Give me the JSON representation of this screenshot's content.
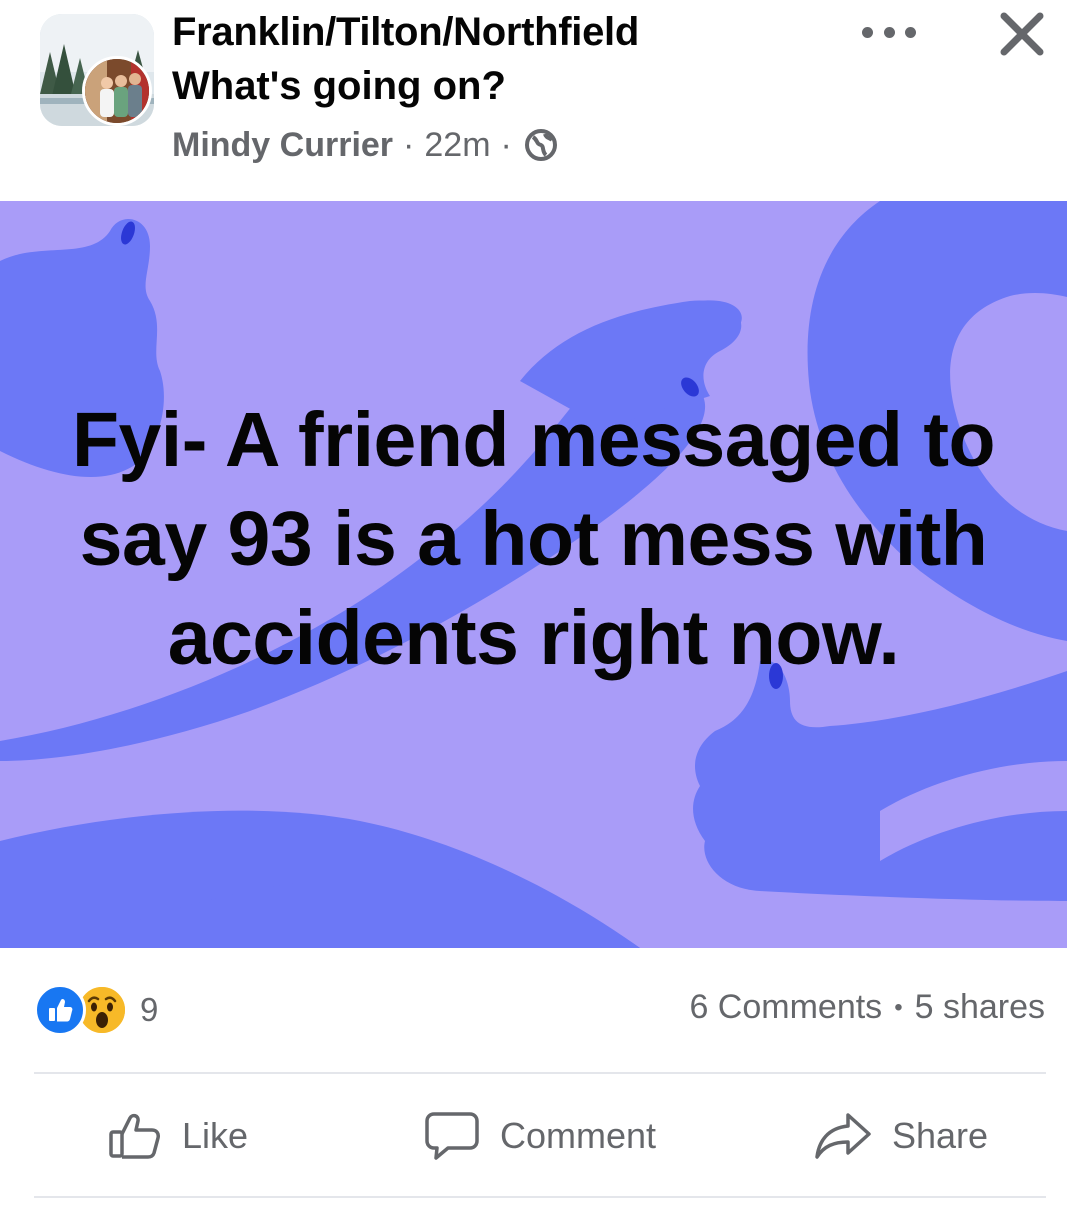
{
  "header": {
    "group_name": "Franklin/Tilton/Northfield",
    "post_title": "What's going on?",
    "author": "Mindy Currier",
    "separator": "·",
    "timestamp": "22m",
    "privacy_icon": "globe-icon",
    "more_icon": "more-options-icon",
    "close_icon": "close-icon"
  },
  "post": {
    "text": "Fyi- A friend messaged to say 93 is a hot mess with accidents right now.",
    "background_color": "#a99cf8",
    "shape_color": "#6c78f6"
  },
  "engagement": {
    "reaction_icons": [
      "like-reaction-icon",
      "wow-reaction-icon"
    ],
    "reaction_count": "9",
    "comments": "6 Comments",
    "dot": "•",
    "shares": "5 shares"
  },
  "actions": {
    "like": "Like",
    "comment": "Comment",
    "share": "Share"
  },
  "colors": {
    "text_primary": "#050505",
    "text_secondary": "#65676b",
    "facebook_blue": "#1877f2",
    "divider": "#e4e6eb"
  }
}
